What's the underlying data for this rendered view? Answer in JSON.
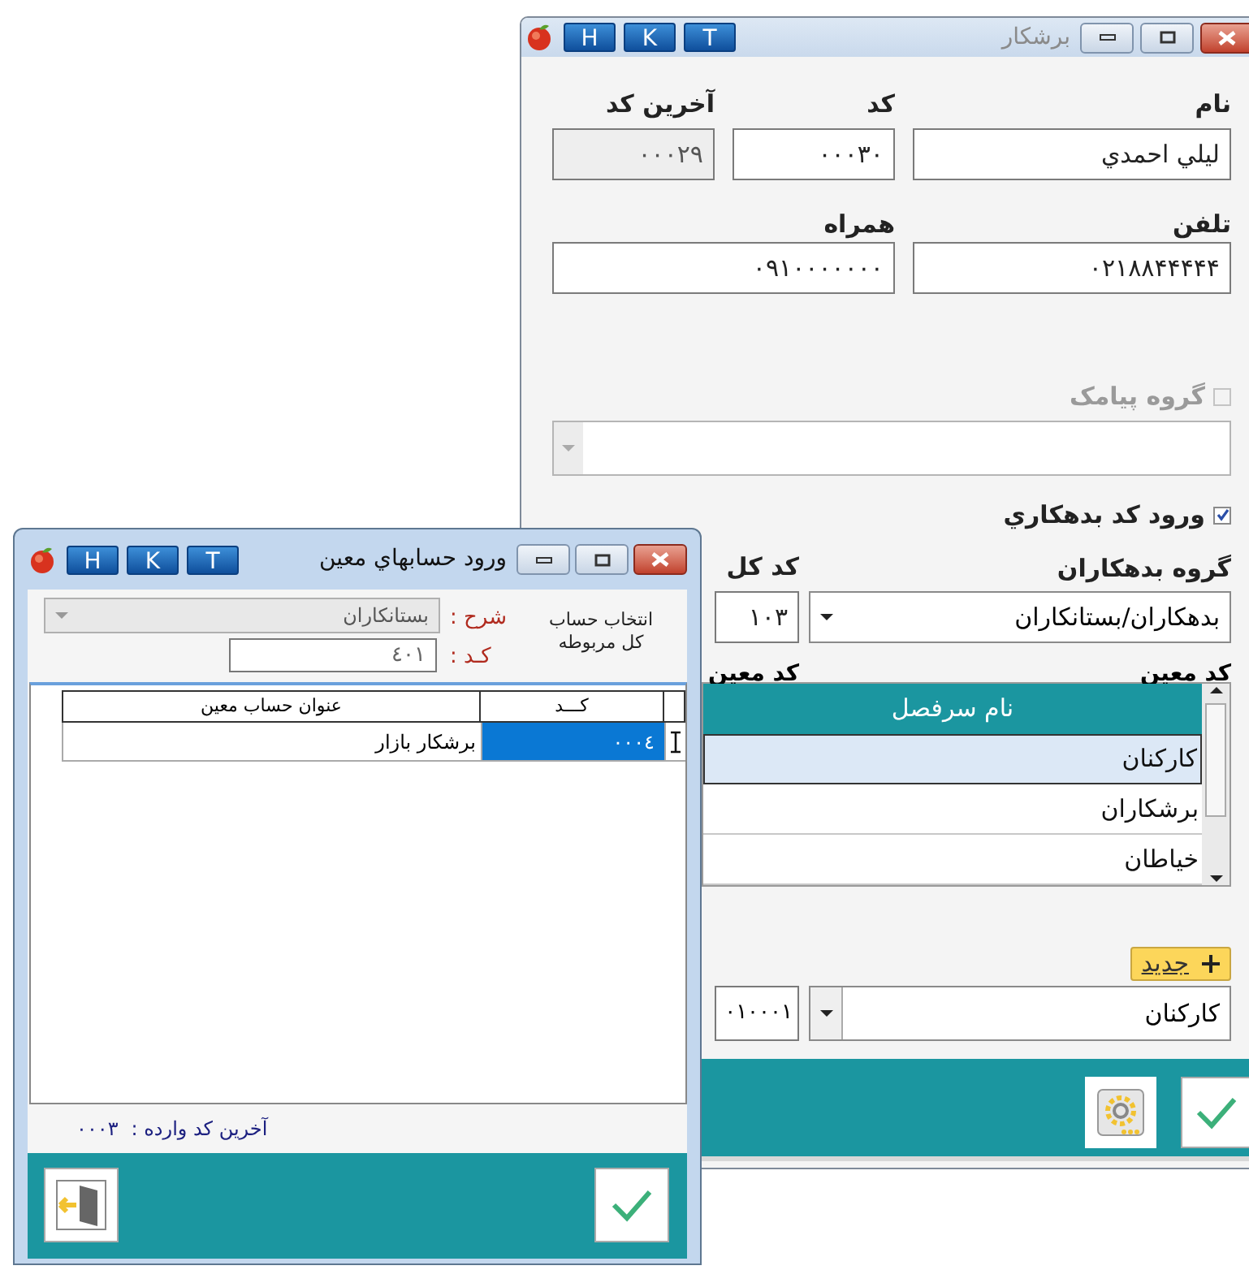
{
  "back_window": {
    "title": "برشكار",
    "quick_buttons": [
      "T",
      "K",
      "H"
    ],
    "name": {
      "label": "نام",
      "value": "ليلي احمدي"
    },
    "code": {
      "label": "کد",
      "value": "۰۰۰۳۰"
    },
    "last_code": {
      "label": "آخرين کد",
      "value": "۰۰۰۲۹",
      "disabled": true
    },
    "phone": {
      "label": "تلفن",
      "value": "۰۲۱۸۸۴۴۴۴۴"
    },
    "mobile": {
      "label": "همراه",
      "value": "۰۹۱۰۰۰۰۰۰۰"
    },
    "sms_group": {
      "label": "گروه پيامک",
      "checked": false,
      "disabled": true
    },
    "sms_combo": {
      "disabled": true
    },
    "debtor_code": {
      "label": "ورود کد بدهکاري",
      "checked": true,
      "disabled": false
    },
    "debtor_group": {
      "label": "گروه بدهکاران",
      "value": "بدهکاران/بستانکاران"
    },
    "general_code": {
      "label": "کد کل",
      "value": "۱۰۳"
    },
    "subsidiary_labels": [
      "کد معين",
      "کد معين"
    ],
    "headings": {
      "column": "نام سرفصل",
      "rows": [
        {
          "name": "کارکنان",
          "selected": true
        },
        {
          "name": "برشکاران",
          "selected": false
        },
        {
          "name": "خياطان",
          "selected": false
        }
      ]
    },
    "new_button": "جديد",
    "subsidiary_code": {
      "value": "۰۱۰۰۰۱"
    },
    "subsidiary_combo": {
      "value": "کارکنان"
    }
  },
  "front_window": {
    "title": "ورود حسابهاي معين",
    "quick_buttons": [
      "T",
      "K",
      "H"
    ],
    "description": {
      "label": "شرح :",
      "value": "بستانكاران"
    },
    "code": {
      "label": "کـد :",
      "value": "٤٠١"
    },
    "hint": "انتخاب حساب کل مربوطه",
    "table": {
      "columns": [
        "کـــد",
        "عنوان حساب معين"
      ],
      "rows": [
        {
          "title": "برشكار بازار",
          "code": "٠٠٠٤",
          "selected": true
        }
      ]
    },
    "last_code": {
      "label": "آخرين کد وارده :",
      "value": "٠٠٠٣"
    }
  }
}
